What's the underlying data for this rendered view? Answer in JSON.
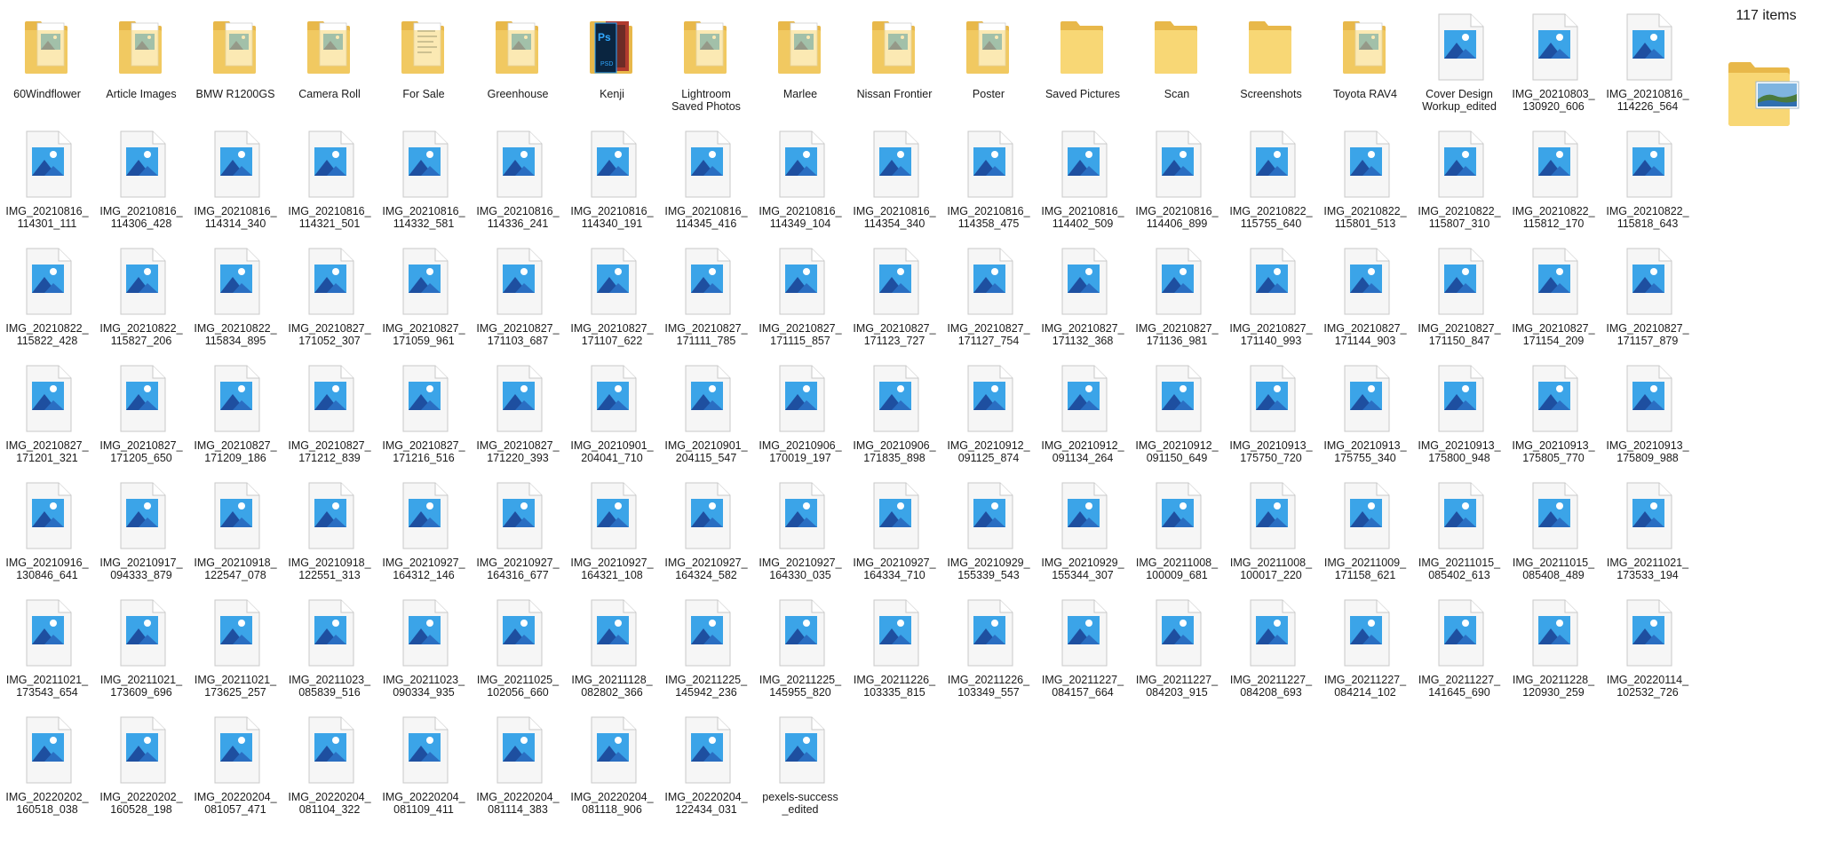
{
  "details": {
    "item_count": "117 items"
  },
  "colors": {
    "folder_back": "#e8b84a",
    "folder_front": "#f8d775",
    "folder_paper": "#ffffff",
    "image_blue_dark": "#1e4fa0",
    "image_blue_light": "#3ba4e8",
    "page_fill": "#f6f6f6",
    "page_border": "#c8c8c8"
  },
  "items": [
    {
      "name": "60Windflower",
      "type": "folder-image"
    },
    {
      "name": "Article Images",
      "type": "folder-image"
    },
    {
      "name": "BMW R1200GS",
      "type": "folder-image"
    },
    {
      "name": "Camera Roll",
      "type": "folder-image"
    },
    {
      "name": "For Sale",
      "type": "folder-doc"
    },
    {
      "name": "Greenhouse",
      "type": "folder-image"
    },
    {
      "name": "Kenji",
      "type": "folder-psd"
    },
    {
      "name": "Lightroom\nSaved Photos",
      "type": "folder-image"
    },
    {
      "name": "Marlee",
      "type": "folder-image"
    },
    {
      "name": "Nissan Frontier",
      "type": "folder-image"
    },
    {
      "name": "Poster",
      "type": "folder-image"
    },
    {
      "name": "Saved Pictures",
      "type": "folder-empty"
    },
    {
      "name": "Scan",
      "type": "folder-empty"
    },
    {
      "name": "Screenshots",
      "type": "folder-empty"
    },
    {
      "name": "Toyota RAV4",
      "type": "folder-image"
    },
    {
      "name": "Cover Design\nWorkup_edited",
      "type": "image"
    },
    {
      "name": "IMG_20210803_\n130920_606",
      "type": "image"
    },
    {
      "name": "IMG_20210816_\n114226_564",
      "type": "image"
    },
    {
      "name": "IMG_20210816_\n114301_111",
      "type": "image"
    },
    {
      "name": "IMG_20210816_\n114306_428",
      "type": "image"
    },
    {
      "name": "IMG_20210816_\n114314_340",
      "type": "image"
    },
    {
      "name": "IMG_20210816_\n114321_501",
      "type": "image"
    },
    {
      "name": "IMG_20210816_\n114332_581",
      "type": "image"
    },
    {
      "name": "IMG_20210816_\n114336_241",
      "type": "image"
    },
    {
      "name": "IMG_20210816_\n114340_191",
      "type": "image"
    },
    {
      "name": "IMG_20210816_\n114345_416",
      "type": "image"
    },
    {
      "name": "IMG_20210816_\n114349_104",
      "type": "image"
    },
    {
      "name": "IMG_20210816_\n114354_340",
      "type": "image"
    },
    {
      "name": "IMG_20210816_\n114358_475",
      "type": "image"
    },
    {
      "name": "IMG_20210816_\n114402_509",
      "type": "image"
    },
    {
      "name": "IMG_20210816_\n114406_899",
      "type": "image"
    },
    {
      "name": "IMG_20210822_\n115755_640",
      "type": "image"
    },
    {
      "name": "IMG_20210822_\n115801_513",
      "type": "image"
    },
    {
      "name": "IMG_20210822_\n115807_310",
      "type": "image"
    },
    {
      "name": "IMG_20210822_\n115812_170",
      "type": "image"
    },
    {
      "name": "IMG_20210822_\n115818_643",
      "type": "image"
    },
    {
      "name": "IMG_20210822_\n115822_428",
      "type": "image"
    },
    {
      "name": "IMG_20210822_\n115827_206",
      "type": "image"
    },
    {
      "name": "IMG_20210822_\n115834_895",
      "type": "image"
    },
    {
      "name": "IMG_20210827_\n171052_307",
      "type": "image"
    },
    {
      "name": "IMG_20210827_\n171059_961",
      "type": "image"
    },
    {
      "name": "IMG_20210827_\n171103_687",
      "type": "image"
    },
    {
      "name": "IMG_20210827_\n171107_622",
      "type": "image"
    },
    {
      "name": "IMG_20210827_\n171111_785",
      "type": "image"
    },
    {
      "name": "IMG_20210827_\n171115_857",
      "type": "image"
    },
    {
      "name": "IMG_20210827_\n171123_727",
      "type": "image"
    },
    {
      "name": "IMG_20210827_\n171127_754",
      "type": "image"
    },
    {
      "name": "IMG_20210827_\n171132_368",
      "type": "image"
    },
    {
      "name": "IMG_20210827_\n171136_981",
      "type": "image"
    },
    {
      "name": "IMG_20210827_\n171140_993",
      "type": "image"
    },
    {
      "name": "IMG_20210827_\n171144_903",
      "type": "image"
    },
    {
      "name": "IMG_20210827_\n171150_847",
      "type": "image"
    },
    {
      "name": "IMG_20210827_\n171154_209",
      "type": "image"
    },
    {
      "name": "IMG_20210827_\n171157_879",
      "type": "image"
    },
    {
      "name": "IMG_20210827_\n171201_321",
      "type": "image"
    },
    {
      "name": "IMG_20210827_\n171205_650",
      "type": "image"
    },
    {
      "name": "IMG_20210827_\n171209_186",
      "type": "image"
    },
    {
      "name": "IMG_20210827_\n171212_839",
      "type": "image"
    },
    {
      "name": "IMG_20210827_\n171216_516",
      "type": "image"
    },
    {
      "name": "IMG_20210827_\n171220_393",
      "type": "image"
    },
    {
      "name": "IMG_20210901_\n204041_710",
      "type": "image"
    },
    {
      "name": "IMG_20210901_\n204115_547",
      "type": "image"
    },
    {
      "name": "IMG_20210906_\n170019_197",
      "type": "image"
    },
    {
      "name": "IMG_20210906_\n171835_898",
      "type": "image"
    },
    {
      "name": "IMG_20210912_\n091125_874",
      "type": "image"
    },
    {
      "name": "IMG_20210912_\n091134_264",
      "type": "image"
    },
    {
      "name": "IMG_20210912_\n091150_649",
      "type": "image"
    },
    {
      "name": "IMG_20210913_\n175750_720",
      "type": "image"
    },
    {
      "name": "IMG_20210913_\n175755_340",
      "type": "image"
    },
    {
      "name": "IMG_20210913_\n175800_948",
      "type": "image"
    },
    {
      "name": "IMG_20210913_\n175805_770",
      "type": "image"
    },
    {
      "name": "IMG_20210913_\n175809_988",
      "type": "image"
    },
    {
      "name": "IMG_20210916_\n130846_641",
      "type": "image"
    },
    {
      "name": "IMG_20210917_\n094333_879",
      "type": "image"
    },
    {
      "name": "IMG_20210918_\n122547_078",
      "type": "image"
    },
    {
      "name": "IMG_20210918_\n122551_313",
      "type": "image"
    },
    {
      "name": "IMG_20210927_\n164312_146",
      "type": "image"
    },
    {
      "name": "IMG_20210927_\n164316_677",
      "type": "image"
    },
    {
      "name": "IMG_20210927_\n164321_108",
      "type": "image"
    },
    {
      "name": "IMG_20210927_\n164324_582",
      "type": "image"
    },
    {
      "name": "IMG_20210927_\n164330_035",
      "type": "image"
    },
    {
      "name": "IMG_20210927_\n164334_710",
      "type": "image"
    },
    {
      "name": "IMG_20210929_\n155339_543",
      "type": "image"
    },
    {
      "name": "IMG_20210929_\n155344_307",
      "type": "image"
    },
    {
      "name": "IMG_20211008_\n100009_681",
      "type": "image"
    },
    {
      "name": "IMG_20211008_\n100017_220",
      "type": "image"
    },
    {
      "name": "IMG_20211009_\n171158_621",
      "type": "image"
    },
    {
      "name": "IMG_20211015_\n085402_613",
      "type": "image"
    },
    {
      "name": "IMG_20211015_\n085408_489",
      "type": "image"
    },
    {
      "name": "IMG_20211021_\n173533_194",
      "type": "image"
    },
    {
      "name": "IMG_20211021_\n173543_654",
      "type": "image"
    },
    {
      "name": "IMG_20211021_\n173609_696",
      "type": "image"
    },
    {
      "name": "IMG_20211021_\n173625_257",
      "type": "image"
    },
    {
      "name": "IMG_20211023_\n085839_516",
      "type": "image"
    },
    {
      "name": "IMG_20211023_\n090334_935",
      "type": "image"
    },
    {
      "name": "IMG_20211025_\n102056_660",
      "type": "image"
    },
    {
      "name": "IMG_20211128_\n082802_366",
      "type": "image"
    },
    {
      "name": "IMG_20211225_\n145942_236",
      "type": "image"
    },
    {
      "name": "IMG_20211225_\n145955_820",
      "type": "image"
    },
    {
      "name": "IMG_20211226_\n103335_815",
      "type": "image"
    },
    {
      "name": "IMG_20211226_\n103349_557",
      "type": "image"
    },
    {
      "name": "IMG_20211227_\n084157_664",
      "type": "image"
    },
    {
      "name": "IMG_20211227_\n084203_915",
      "type": "image"
    },
    {
      "name": "IMG_20211227_\n084208_693",
      "type": "image"
    },
    {
      "name": "IMG_20211227_\n084214_102",
      "type": "image"
    },
    {
      "name": "IMG_20211227_\n141645_690",
      "type": "image"
    },
    {
      "name": "IMG_20211228_\n120930_259",
      "type": "image"
    },
    {
      "name": "IMG_20220114_\n102532_726",
      "type": "image"
    },
    {
      "name": "IMG_20220202_\n160518_038",
      "type": "image"
    },
    {
      "name": "IMG_20220202_\n160528_198",
      "type": "image"
    },
    {
      "name": "IMG_20220204_\n081057_471",
      "type": "image"
    },
    {
      "name": "IMG_20220204_\n081104_322",
      "type": "image"
    },
    {
      "name": "IMG_20220204_\n081109_411",
      "type": "image"
    },
    {
      "name": "IMG_20220204_\n081114_383",
      "type": "image"
    },
    {
      "name": "IMG_20220204_\n081118_906",
      "type": "image"
    },
    {
      "name": "IMG_20220204_\n122434_031",
      "type": "image"
    },
    {
      "name": "pexels-success\n_edited",
      "type": "image"
    }
  ]
}
